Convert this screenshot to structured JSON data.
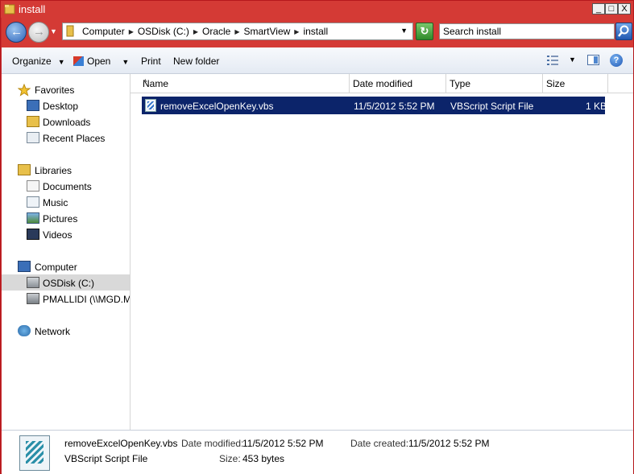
{
  "window": {
    "title": "install",
    "controls": {
      "minimize": "_",
      "maximize": "□",
      "close": "X"
    }
  },
  "address": {
    "crumbs": [
      "Computer",
      "OSDisk (C:)",
      "Oracle",
      "SmartView",
      "install"
    ],
    "search_placeholder": "Search install"
  },
  "toolbar": {
    "organize": "Organize",
    "open": "Open",
    "print": "Print",
    "new_folder": "New folder"
  },
  "nav": {
    "favorites": {
      "label": "Favorites",
      "items": [
        "Desktop",
        "Downloads",
        "Recent Places"
      ]
    },
    "libraries": {
      "label": "Libraries",
      "items": [
        "Documents",
        "Music",
        "Pictures",
        "Videos"
      ]
    },
    "computer": {
      "label": "Computer",
      "items": [
        "OSDisk (C:)",
        "PMALLIDI (\\\\MGD.MRS"
      ]
    },
    "network": {
      "label": "Network"
    }
  },
  "columns": {
    "name": "Name",
    "date_modified": "Date modified",
    "type": "Type",
    "size": "Size"
  },
  "files": [
    {
      "name": "removeExcelOpenKey.vbs",
      "date_modified": "11/5/2012 5:52 PM",
      "type": "VBScript Script File",
      "size": "1 KB"
    }
  ],
  "details": {
    "filename": "removeExcelOpenKey.vbs",
    "filetype": "VBScript Script File",
    "date_modified_label": "Date modified:",
    "date_modified": "11/5/2012 5:52 PM",
    "size_label": "Size:",
    "size": "453 bytes",
    "date_created_label": "Date created:",
    "date_created": "11/5/2012 5:52 PM"
  }
}
